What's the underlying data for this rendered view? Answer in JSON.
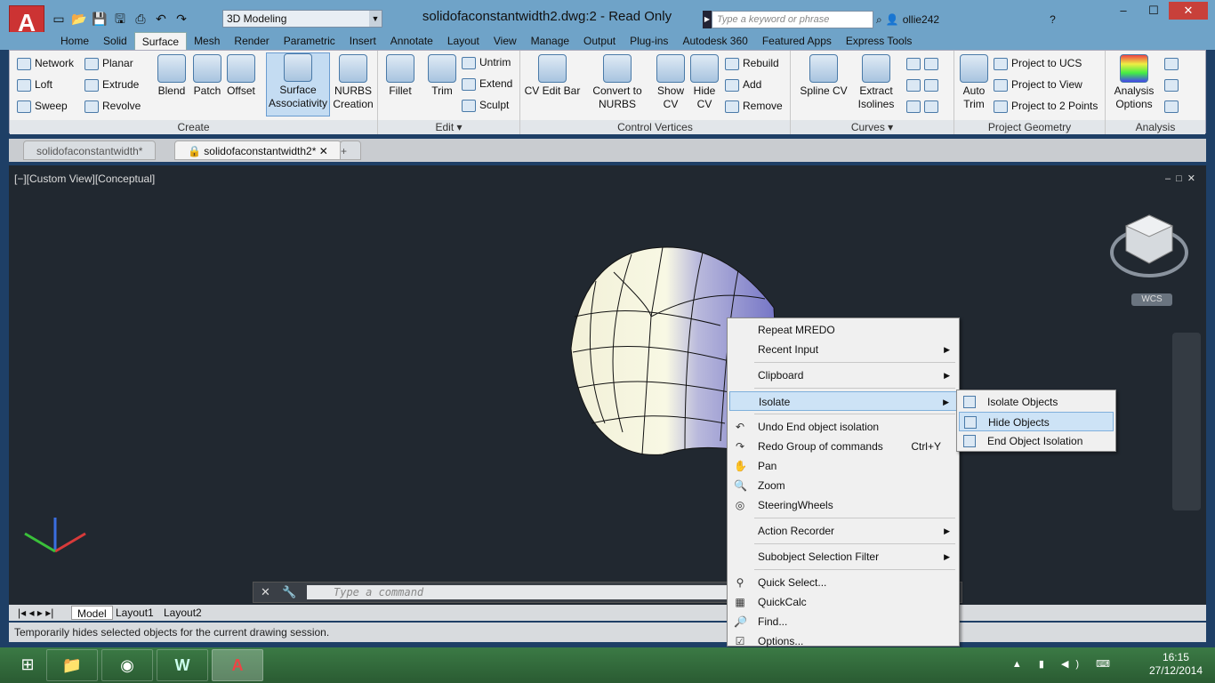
{
  "window": {
    "title": "solidofaconstantwidth2.dwg:2 - Read Only",
    "app_button": "A",
    "workspace": "3D Modeling",
    "search_placeholder": "Type a keyword or phrase",
    "user": "ollie242",
    "controls": [
      "–",
      "☐",
      "✕"
    ]
  },
  "ribbon_tabs": [
    {
      "label": "Home",
      "active": false
    },
    {
      "label": "Solid",
      "active": false
    },
    {
      "label": "Surface",
      "active": true
    },
    {
      "label": "Mesh",
      "active": false
    },
    {
      "label": "Render",
      "active": false
    },
    {
      "label": "Parametric",
      "active": false
    },
    {
      "label": "Insert",
      "active": false
    },
    {
      "label": "Annotate",
      "active": false
    },
    {
      "label": "Layout",
      "active": false
    },
    {
      "label": "View",
      "active": false
    },
    {
      "label": "Manage",
      "active": false
    },
    {
      "label": "Output",
      "active": false
    },
    {
      "label": "Plug-ins",
      "active": false
    },
    {
      "label": "Autodesk 360",
      "active": false
    },
    {
      "label": "Featured Apps",
      "active": false
    },
    {
      "label": "Express Tools",
      "active": false
    }
  ],
  "panels": {
    "create": {
      "title": "Create",
      "small": [
        "Network",
        "Loft",
        "Sweep",
        "Planar",
        "Extrude",
        "Revolve"
      ],
      "large": [
        "Blend",
        "Patch",
        "Offset",
        "Surface\nAssociativity",
        "NURBS\nCreation"
      ]
    },
    "edit": {
      "title": "Edit ▾",
      "large": [
        "Fillet",
        "Trim"
      ],
      "small": [
        "Untrim",
        "Extend",
        "Sculpt"
      ]
    },
    "control_vertices": {
      "title": "Control Vertices",
      "large": [
        "CV Edit Bar",
        "Convert to\nNURBS",
        "Show\nCV",
        "Hide\nCV"
      ],
      "small": [
        "Rebuild",
        "Add",
        "Remove"
      ]
    },
    "curves": {
      "title": "Curves ▾",
      "large": [
        "Spline CV",
        "Extract\nIsolines"
      ]
    },
    "project_geometry": {
      "title": "Project Geometry",
      "large": [
        "Auto\nTrim"
      ],
      "small": [
        "Project to UCS",
        "Project to View",
        "Project to 2 Points"
      ]
    },
    "analysis": {
      "title": "Analysis",
      "large": [
        "Analysis\nOptions"
      ]
    }
  },
  "doc_tabs": [
    {
      "label": "solidofaconstantwidth*",
      "active": false
    },
    {
      "label": "solidofaconstantwidth2*",
      "active": true
    }
  ],
  "viewport": {
    "label": "[−][Custom View][Conceptual]",
    "wcs": "WCS"
  },
  "command_line": {
    "placeholder": "Type a command"
  },
  "layout_tabs": [
    "Model",
    "Layout1",
    "Layout2"
  ],
  "status_text": "Temporarily hides selected objects for the current drawing session.",
  "context_menu": {
    "items": [
      {
        "label": "Repeat MREDO"
      },
      {
        "label": "Recent Input",
        "submenu": true
      },
      {
        "label": "Clipboard",
        "submenu": true
      },
      {
        "label": "Isolate",
        "submenu": true,
        "highlight": true
      },
      {
        "label": "Undo End object isolation"
      },
      {
        "label": "Redo Group of commands",
        "shortcut": "Ctrl+Y"
      },
      {
        "label": "Pan"
      },
      {
        "label": "Zoom"
      },
      {
        "label": "SteeringWheels"
      },
      {
        "label": "Action Recorder",
        "submenu": true
      },
      {
        "label": "Subobject Selection Filter",
        "submenu": true
      },
      {
        "label": "Quick Select..."
      },
      {
        "label": "QuickCalc"
      },
      {
        "label": "Find..."
      },
      {
        "label": "Options..."
      }
    ]
  },
  "isolate_submenu": [
    {
      "label": "Isolate Objects"
    },
    {
      "label": "Hide Objects",
      "highlight": true
    },
    {
      "label": "End Object Isolation"
    }
  ],
  "taskbar": {
    "time": "16:15",
    "date": "27/12/2014"
  },
  "colors": {
    "accent": "#cde3f6",
    "viewport_bg": "#212830",
    "title_bg": "#6fa3c8"
  }
}
